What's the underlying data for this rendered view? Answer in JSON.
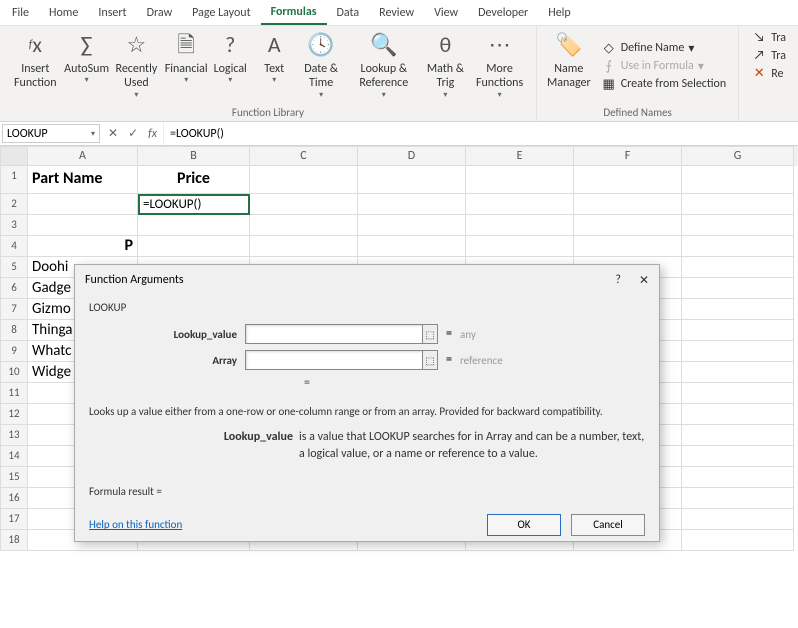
{
  "menubar": [
    "File",
    "Home",
    "Insert",
    "Draw",
    "Page Layout",
    "Formulas",
    "Data",
    "Review",
    "View",
    "Developer",
    "Help"
  ],
  "active_menu": 5,
  "ribbon": {
    "insert_function": "Insert\nFunction",
    "autosum": "AutoSum",
    "recently": "Recently\nUsed",
    "financial": "Financial",
    "logical": "Logical",
    "text": "Text",
    "datetime": "Date &\nTime",
    "lookup": "Lookup &\nReference",
    "math": "Math &\nTrig",
    "more": "More\nFunctions",
    "library_label": "Function Library",
    "name_mgr": "Name\nManager",
    "define_name": "Define Name",
    "use_in_formula": "Use in Formula",
    "create_selection": "Create from Selection",
    "defined_label": "Defined Names",
    "trace1": "Tra",
    "trace2": "Tra",
    "remove": "Re"
  },
  "namebox": "LOOKUP",
  "formula_value": "=LOOKUP()",
  "columns": [
    "A",
    "B",
    "C",
    "D",
    "E",
    "F",
    "G"
  ],
  "row_headers": [
    "1",
    "2",
    "3",
    "4",
    "5",
    "6",
    "7",
    "8",
    "9",
    "10",
    "11",
    "12",
    "13",
    "14",
    "15",
    "16",
    "17",
    "18"
  ],
  "cells": {
    "A1": "Part Name",
    "B1": "Price",
    "B2": "=LOOKUP()",
    "A4": "P",
    "A5": "Doohi",
    "A6": "Gadge",
    "A7": "Gizmo",
    "A8": "Thinga",
    "A9": "Whatc",
    "A10": "Widge"
  },
  "dialog": {
    "title": "Function Arguments",
    "function": "LOOKUP",
    "arg1_label": "Lookup_value",
    "arg1_value": "",
    "arg1_hint": "any",
    "arg2_label": "Array",
    "arg2_value": "",
    "arg2_hint": "reference",
    "eq": "=",
    "description": "Looks up a value either from a one-row or one-column range or from an array. Provided for backward compatibility.",
    "arg_name": "Lookup_value",
    "arg_desc": "is a value that LOOKUP searches for in Array and can be a number, text, a logical value, or a name or reference to a value.",
    "result_label": "Formula result =",
    "help": "Help on this function",
    "ok": "OK",
    "cancel": "Cancel"
  }
}
